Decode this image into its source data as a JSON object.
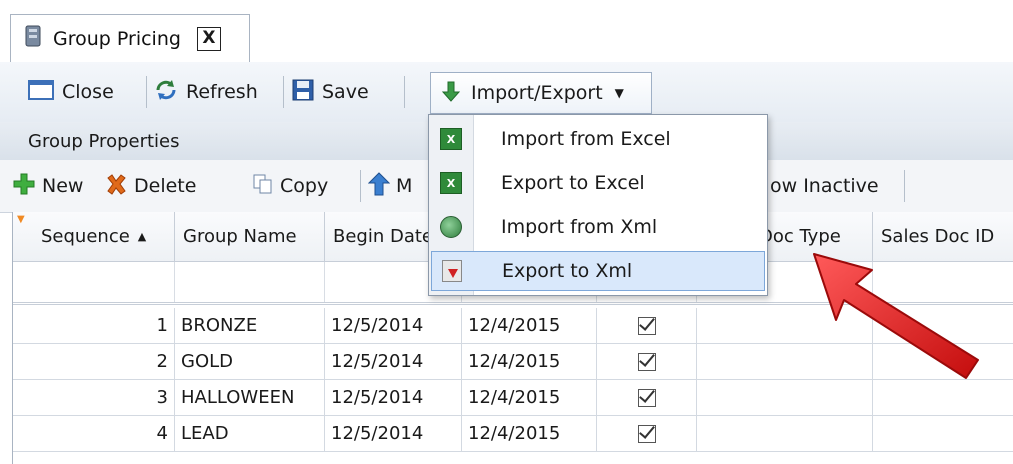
{
  "tab": {
    "title": "Group Pricing",
    "close_glyph": "X"
  },
  "toolbar": {
    "close_label": "Close",
    "refresh_label": "Refresh",
    "save_label": "Save",
    "import_export_label": "Import/Export"
  },
  "group": {
    "header": "Group Properties"
  },
  "toolbar2": {
    "new_label": "New",
    "delete_label": "Delete",
    "copy_label": "Copy",
    "move_label_partial": "M",
    "show_inactive_partial": "ow Inactive"
  },
  "grid": {
    "columns": [
      "Sequence",
      "Group Name",
      "Begin Date",
      "",
      "",
      "Doc Type",
      "Sales Doc ID"
    ],
    "sort_indicator": "▲",
    "rows": [
      {
        "seq": "1",
        "name": "BRONZE",
        "begin": "12/5/2014",
        "end": "12/4/2015"
      },
      {
        "seq": "2",
        "name": "GOLD",
        "begin": "12/5/2014",
        "end": "12/4/2015"
      },
      {
        "seq": "3",
        "name": "HALLOWEEN",
        "begin": "12/5/2014",
        "end": "12/4/2015"
      },
      {
        "seq": "4",
        "name": "LEAD",
        "begin": "12/5/2014",
        "end": "12/4/2015"
      }
    ]
  },
  "menu": {
    "items": [
      {
        "label": "Import from Excel",
        "icon": "excel-icon"
      },
      {
        "label": "Export to Excel",
        "icon": "excel-icon"
      },
      {
        "label": "Import from Xml",
        "icon": "xml-import-icon"
      },
      {
        "label": "Export to Xml",
        "icon": "xml-export-icon"
      }
    ],
    "selected_index": 3
  },
  "colors": {
    "accent": "#d9e8fb",
    "arrow": "#e02020",
    "excel": "#2f8a3a"
  }
}
